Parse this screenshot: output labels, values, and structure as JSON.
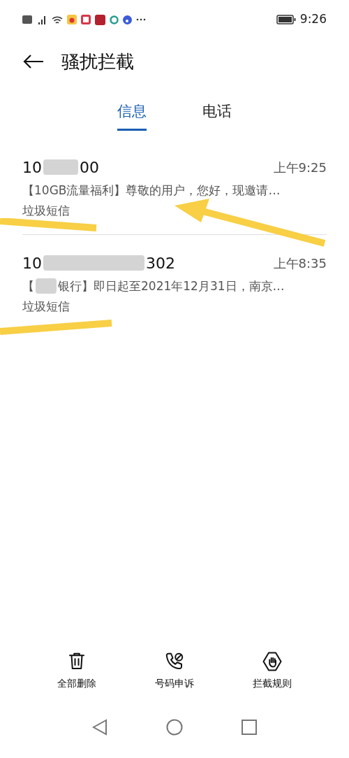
{
  "status_bar": {
    "time": "9:26"
  },
  "header": {
    "title": "骚扰拦截"
  },
  "tabs": [
    {
      "label": "信息",
      "selected": true
    },
    {
      "label": "电话",
      "selected": false
    }
  ],
  "messages": [
    {
      "sender_start": "10",
      "sender_end": "00",
      "time": "上午9:25",
      "preview_end": "【10GB流量福利】尊敬的用户，您好，现邀请…",
      "tag": "垃圾短信"
    },
    {
      "sender_start": "10",
      "sender_end": "302",
      "time": "上午8:35",
      "preview_start": "【",
      "preview_end": "银行】即日起至2021年12月31日，南京…",
      "tag": "垃圾短信"
    }
  ],
  "actions": [
    {
      "kind": "delete",
      "label": "全部删除"
    },
    {
      "kind": "appeal",
      "label": "号码申诉"
    },
    {
      "kind": "rules",
      "label": "拦截规则"
    }
  ]
}
